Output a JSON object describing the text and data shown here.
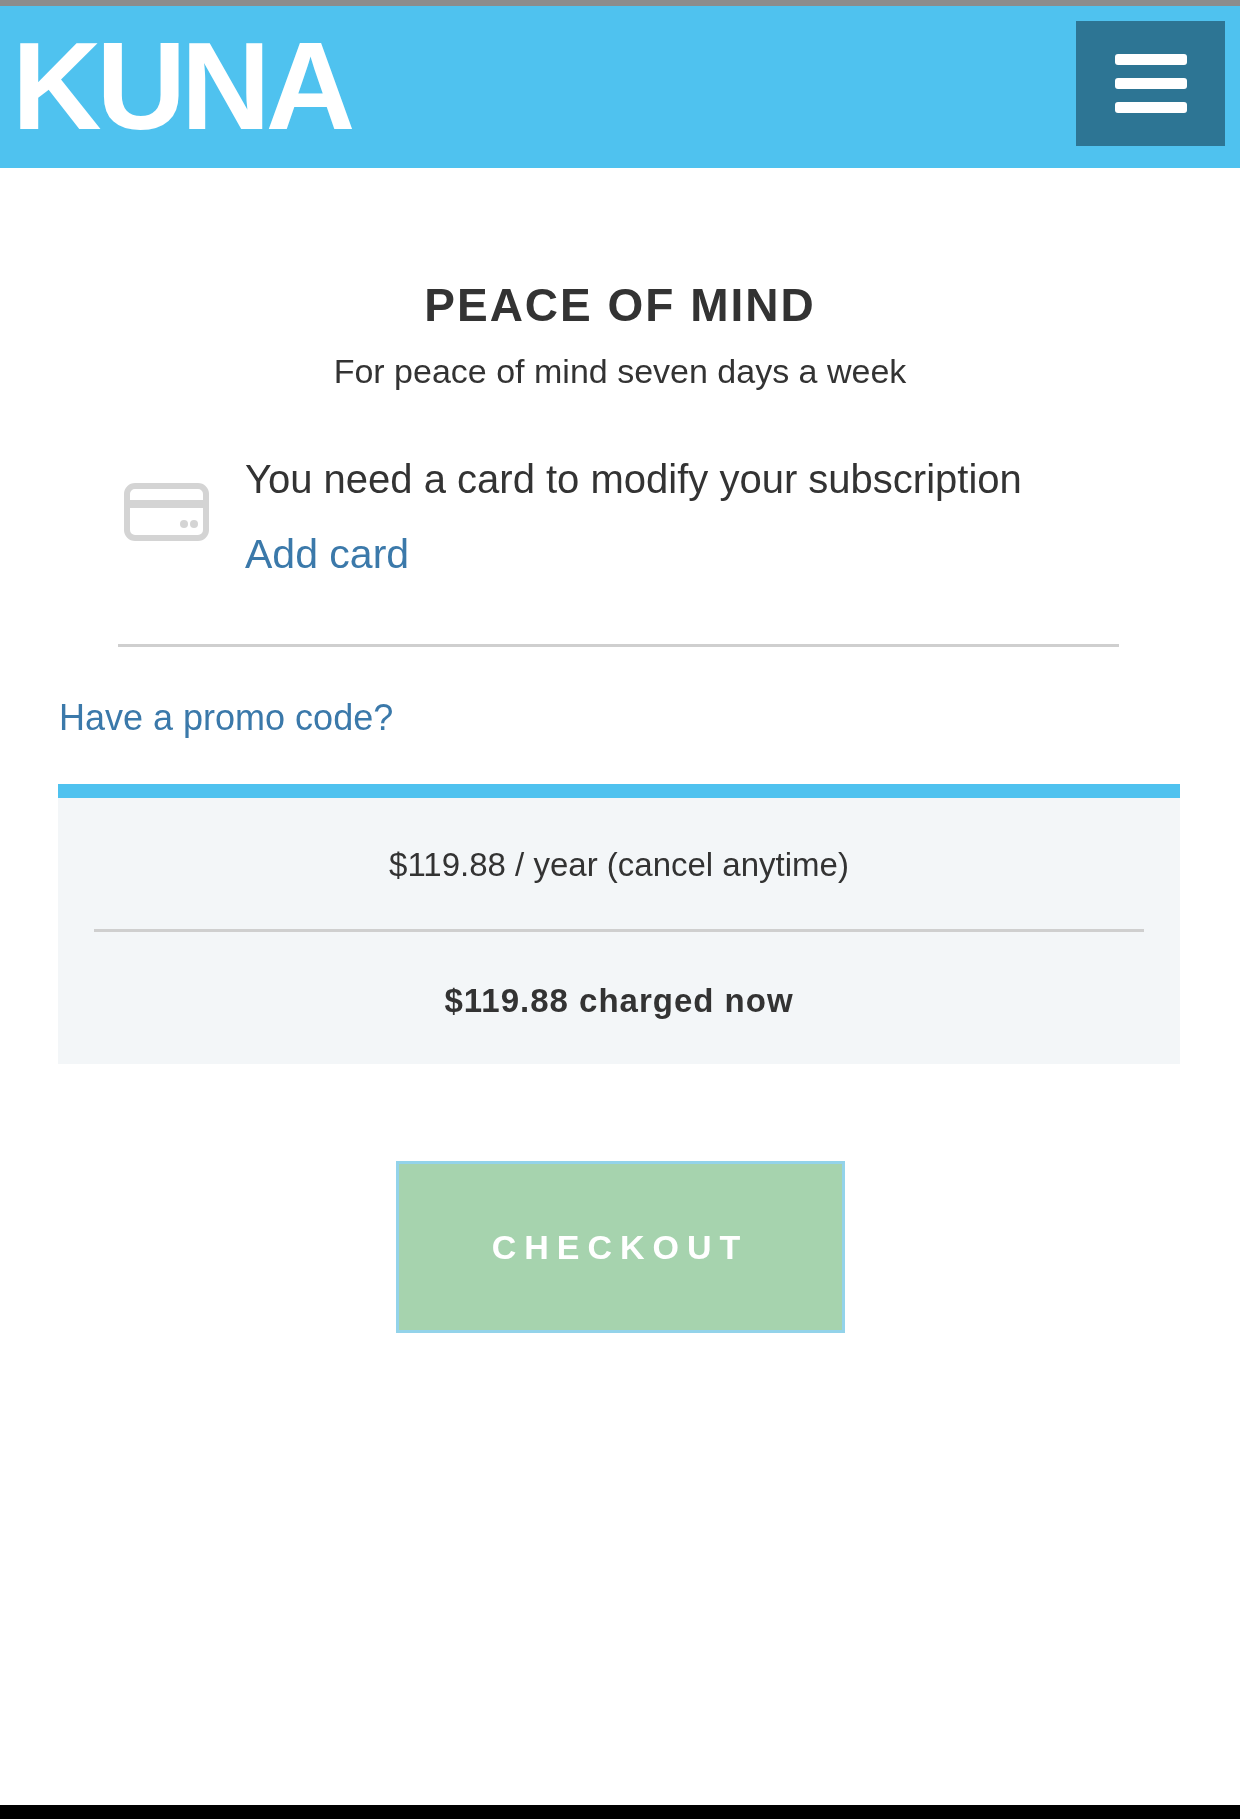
{
  "header": {
    "logo": "KUNA"
  },
  "plan": {
    "title": "PEACE OF MIND",
    "subtitle": "For peace of mind seven days a week"
  },
  "card_notice": {
    "message": "You need a card to modify your subscription",
    "link": "Add card"
  },
  "promo_link": "Have a promo code?",
  "summary": {
    "price_line": "$119.88 / year (cancel anytime)",
    "charge_line": "$119.88 charged now"
  },
  "checkout_button": {
    "label": "CHECKOUT",
    "disabled": true
  }
}
